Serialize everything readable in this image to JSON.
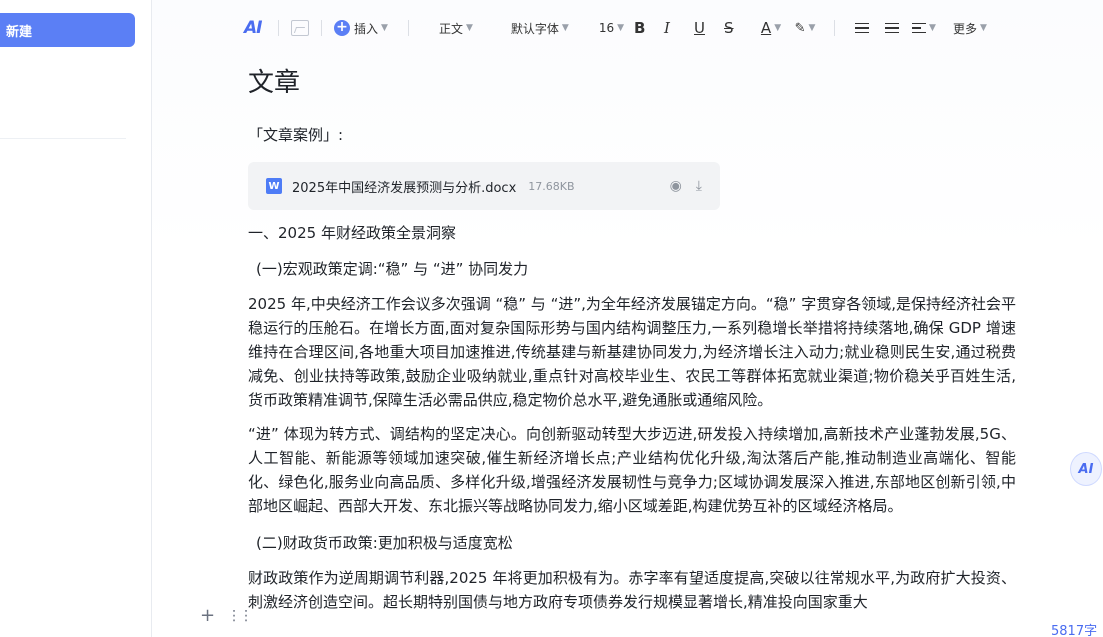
{
  "sidebar": {
    "new_label": "新建"
  },
  "toolbar": {
    "ai_label": "AI",
    "insert_label": "插入",
    "style_label": "正文",
    "font_label": "默认字体",
    "size_label": "16",
    "bold": "B",
    "italic": "I",
    "underline": "U",
    "strike": "S",
    "color": "A",
    "more_label": "更多"
  },
  "doc": {
    "title": "文章",
    "case_label": "「文章案例」:",
    "attachment": {
      "name": "2025年中国经济发展预测与分析.docx",
      "size": "17.68KB",
      "icon": "W"
    },
    "h1": "一、2025 年财经政策全景洞察",
    "h2a": "(一)宏观政策定调:“稳” 与 “进” 协同发力",
    "p1": "2025 年,中央经济工作会议多次强调 “稳” 与 “进”,为全年经济发展锚定方向。“稳” 字贯穿各领域,是保持经济社会平稳运行的压舱石。在增长方面,面对复杂国际形势与国内结构调整压力,一系列稳增长举措将持续落地,确保 GDP 增速维持在合理区间,各地重大项目加速推进,传统基建与新基建协同发力,为经济增长注入动力;就业稳则民生安,通过税费减免、创业扶持等政策,鼓励企业吸纳就业,重点针对高校毕业生、农民工等群体拓宽就业渠道;物价稳关乎百姓生活,货币政策精准调节,保障生活必需品供应,稳定物价总水平,避免通胀或通缩风险。",
    "p2": "“进” 体现为转方式、调结构的坚定决心。向创新驱动转型大步迈进,研发投入持续增加,高新技术产业蓬勃发展,5G、人工智能、新能源等领域加速突破,催生新经济增长点;产业结构优化升级,淘汰落后产能,推动制造业高端化、智能化、绿色化,服务业向高品质、多样化升级,增强经济发展韧性与竞争力;区域协调发展深入推进,东部地区创新引领,中部地区崛起、西部大开发、东北振兴等战略协同发力,缩小区域差距,构建优势互补的区域经济格局。",
    "h2b": "(二)财政货币政策:更加积极与适度宽松",
    "p3": "财政政策作为逆周期调节利器,2025 年将更加积极有为。赤字率有望适度提高,突破以往常规水平,为政府扩大投资、刺激经济创造空间。超长期特别国债与地方政府专项债券发行规模显著增长,精准投向国家重大"
  },
  "float_ai_label": "AI",
  "word_count": "5817字",
  "colors": {
    "accent": "#5b7ff5",
    "word_icon": "#4e7cf6"
  }
}
